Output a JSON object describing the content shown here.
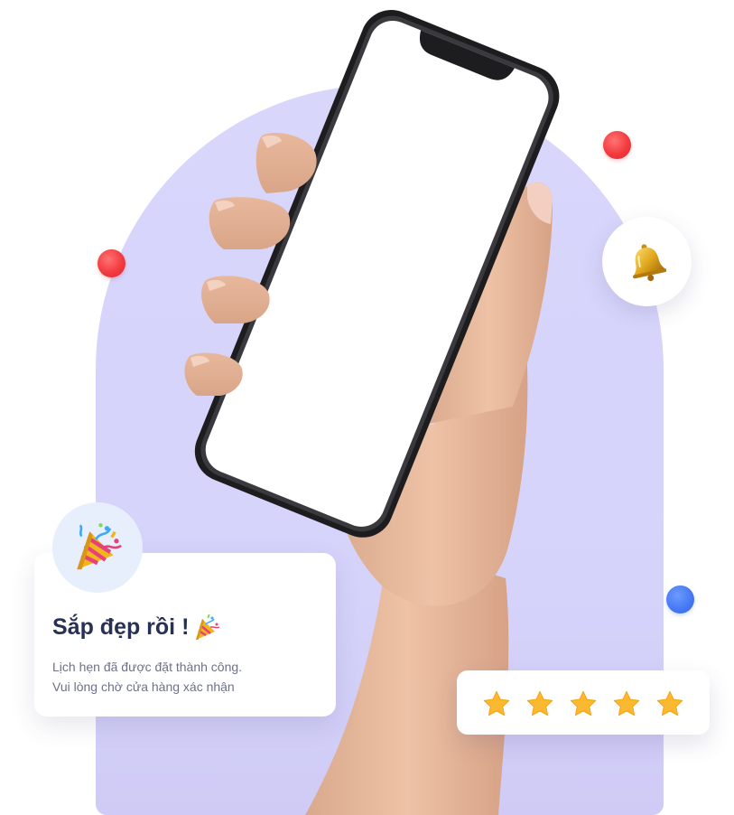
{
  "success_card": {
    "title": "Sắp đẹp rồi !",
    "title_emoji_icon": "party-popper-icon",
    "message_line_1": "Lịch hẹn đã được đặt thành công.",
    "message_line_2": "Vui lòng chờ cửa hàng xác nhận"
  },
  "badges": {
    "notification_icon": "bell-icon",
    "celebration_icon": "party-popper-icon"
  },
  "rating": {
    "value": 5,
    "max": 5,
    "icon": "star-icon"
  },
  "colors": {
    "arch_background": "#d7d5fb",
    "accent_red": "#f0353b",
    "accent_blue": "#4477f3",
    "star": "#fdb831",
    "title_text": "#263154",
    "body_text": "#6c7187"
  }
}
